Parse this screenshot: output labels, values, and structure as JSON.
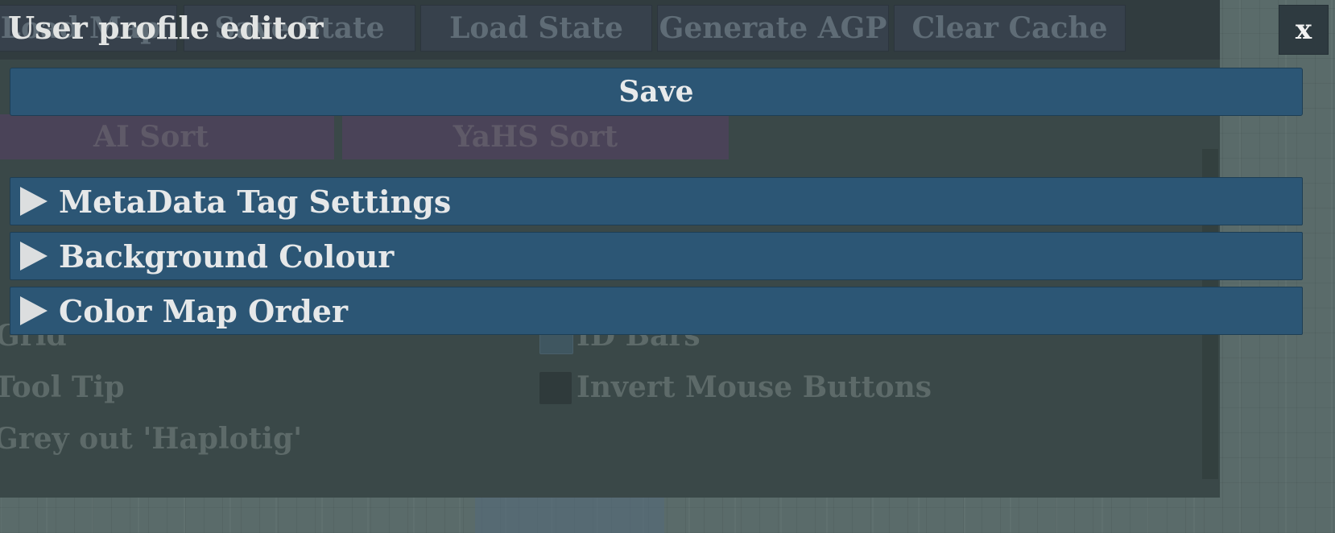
{
  "dialog": {
    "title": "User profile editor",
    "close_label": "x",
    "save_label": "Save",
    "sections": [
      {
        "label": "MetaData Tag Settings",
        "icon": "triangle-right-icon"
      },
      {
        "label": "Background Colour",
        "icon": "triangle-right-icon"
      },
      {
        "label": "Color Map Order",
        "icon": "triangle-right-icon"
      }
    ]
  },
  "background_app": {
    "toolbar": [
      "Load Map",
      "Save State",
      "Load State",
      "Generate AGP",
      "Clear Cache"
    ],
    "sort_buttons": [
      "AI Sort",
      "YaHS Sort"
    ],
    "left_options": [
      "Grid",
      "Tool Tip",
      "Grey out 'Haplotig'"
    ],
    "right_options": [
      "ID Bars",
      "Invert Mouse Buttons"
    ]
  },
  "colors": {
    "accent": "#2c5675",
    "sort_button": "#4a4358",
    "overlay": "#3a4848"
  }
}
